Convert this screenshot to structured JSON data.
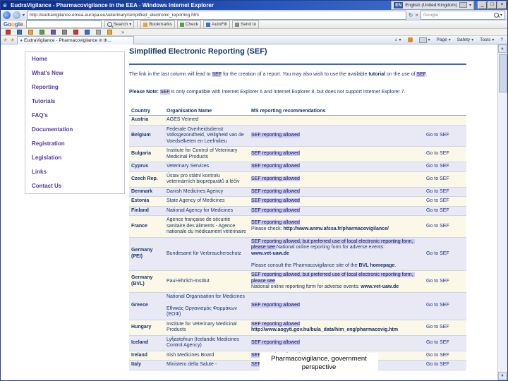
{
  "window": {
    "title": "EudraVigilance - Pharmacovigilance in the EEA - Windows Internet Explorer",
    "language_badge": "EN",
    "language_label": "English (United Kingdom)",
    "min_glyph": "_",
    "max_glyph": "□",
    "close_glyph": "×"
  },
  "icons": {
    "ie": "e",
    "back": "←",
    "forward": "→",
    "refresh": "↻",
    "stop": "×",
    "caret": "▾",
    "star": "★",
    "star_plus": "★",
    "favicon": "●",
    "home": "⌂",
    "help": "?",
    "up_arrow": "▲",
    "down_arrow": "▼",
    "overflow": "»"
  },
  "address_bar": {
    "url": "http://eudravigilance.emea.europa.eu/veterinary/simplified_electronic_reporting.htm",
    "search_placeholder": "Google"
  },
  "google_toolbar": {
    "logo": "Google",
    "logo_colors": [
      "#3366cc",
      "#cc3333",
      "#eeb211",
      "#3366cc",
      "#109d58",
      "#cc3333"
    ],
    "search_label": "Search",
    "items": [
      {
        "label": "Bookmarks",
        "icon": "bookmark-icon",
        "color": "#e8a33d"
      },
      {
        "label": "Check",
        "icon": "spellcheck-icon",
        "color": "#5a9e4a"
      },
      {
        "label": "AutoFill",
        "icon": "autofill-icon",
        "color": "#3a6fc4"
      },
      {
        "label": "Send to",
        "icon": "send-icon",
        "color": "#888888"
      }
    ]
  },
  "links_toolbar": {
    "icon_colors": [
      "#c23b2e",
      "#3a6fc4",
      "#e8a33d",
      "#5a9e4a",
      "#7a52a8",
      "#888888",
      "#c23b2e",
      "#3a6fc4",
      "#aaaaaa",
      "#e8a33d"
    ],
    "overflow_glyph": "»"
  },
  "tab_bar": {
    "tab_title": "EudraVigilance - Pharmacovigilance in th...",
    "commands": {
      "page": "Page",
      "safety": "Safety",
      "tools": "Tools",
      "help": "?"
    }
  },
  "sidebar": {
    "items": [
      "Home",
      "What's New",
      "Reporting",
      "Tutorials",
      "FAQ's",
      "Documentation",
      "Registration",
      "Legislation",
      "Links",
      "Contact Us"
    ]
  },
  "content": {
    "heading": "Simplified Electronic Reporting (SEF)",
    "intro_segments": [
      {
        "text": "The link in the last column will lead to ",
        "style": "plain"
      },
      {
        "text": "SEF",
        "style": "hl"
      },
      {
        "text": " for the creation of a report. You may also wish to use the available ",
        "style": "plain"
      },
      {
        "text": "tutorial",
        "style": "link"
      },
      {
        "text": " on the use of ",
        "style": "plain"
      },
      {
        "text": "SEF",
        "style": "hl"
      },
      {
        "text": ".",
        "style": "plain"
      }
    ],
    "note_segments": [
      {
        "text": "Please Note: ",
        "style": "bold"
      },
      {
        "text": "SEF",
        "style": "hl"
      },
      {
        "text": " is only compatible with Internet Explorer 6 and Internet Explorer 8, but does not support Internet Explorer 7.",
        "style": "plain"
      }
    ],
    "table": {
      "headers": [
        "Country",
        "Organisation Name",
        "MS reporting recommendations",
        ""
      ],
      "rows": [
        {
          "country": "Austria",
          "organisation": "AGES Vetmed",
          "recommendation": [],
          "link": ""
        },
        {
          "country": "Belgium",
          "organisation": "Federale Overheidsdienst Volksgezondheid, Veiligheid van de Voedselketen en Leefmilieu",
          "recommendation": [
            {
              "text": "SEF reporting allowed",
              "style": "hl"
            }
          ],
          "link": "Go to SEF"
        },
        {
          "country": "Bulgaria",
          "organisation": "Institute for Control of Veterinary Medicinal Products",
          "recommendation": [
            {
              "text": "SEF reporting allowed",
              "style": "hl"
            }
          ],
          "link": "Go to SEF"
        },
        {
          "country": "Cyprus",
          "organisation": "Veterinary Services",
          "recommendation": [
            {
              "text": "SEF reporting allowed",
              "style": "hl"
            }
          ],
          "link": "Go to SEF"
        },
        {
          "country": "Czech Rep.",
          "organisation": "Ústav pro státní kontrolu veterinárních biopreparátů a léčiv",
          "recommendation": [
            {
              "text": "SEF reporting allowed",
              "style": "hl"
            }
          ],
          "link": "Go to SEF"
        },
        {
          "country": "Denmark",
          "organisation": "Danish Medicines Agency",
          "recommendation": [
            {
              "text": "SEF reporting allowed",
              "style": "hl"
            }
          ],
          "link": "Go to SEF"
        },
        {
          "country": "Estonia",
          "organisation": "State Agency of Medicines",
          "recommendation": [
            {
              "text": "SEF reporting allowed",
              "style": "hl"
            }
          ],
          "link": "Go to SEF"
        },
        {
          "country": "Finland",
          "organisation": "National Agency for Medicines",
          "recommendation": [
            {
              "text": "SEF reporting allowed",
              "style": "hl"
            }
          ],
          "link": "Go to SEF"
        },
        {
          "country": "France",
          "organisation": "Agence française de sécurité sanitaire des aliments - Agence nationale du médicament vétérinaire",
          "recommendation": [
            {
              "text": "SEF reporting allowed",
              "style": "hl"
            },
            {
              "text": "\nPlease check: ",
              "style": "plain"
            },
            {
              "text": "http://www.anmv.afssa.fr/pharmacovigilance/",
              "style": "link"
            }
          ],
          "link": "Go to SEF"
        },
        {
          "country": "Germany (PEI)",
          "organisation": "Bundesamt für Verbraucherschutz",
          "recommendation": [
            {
              "text": "SEF reporting allowed, but preferred use of local electronic reporting form, please see ",
              "style": "hl"
            },
            {
              "text": "National online reporting form for adverse events:\n",
              "style": "plain"
            },
            {
              "text": "www.vet-uaw.de",
              "style": "link"
            },
            {
              "text": "\n\nPlease consult the Pharmacovigilance site of the ",
              "style": "plain"
            },
            {
              "text": "BVL homepage",
              "style": "link"
            },
            {
              "text": ".",
              "style": "plain"
            }
          ],
          "link": "Go to SEF"
        },
        {
          "country": "Germany (BVL)",
          "organisation": "Paul-Ehrlich-Institut",
          "recommendation": [
            {
              "text": "SEF reporting allowed, but preferred use of local electronic reporting form, please see\n",
              "style": "hl"
            },
            {
              "text": "National online reporting form for adverse events: ",
              "style": "plain"
            },
            {
              "text": "www.vet-uaw.de",
              "style": "link"
            }
          ],
          "link": "Go to SEF"
        },
        {
          "country": "Greece",
          "organisation": "National Organisation for Medicines\n\nΕθνικός Οργανισμός Φαρμάκων (ΕΟΦ)",
          "recommendation": [
            {
              "text": "SEF reporting allowed",
              "style": "hl"
            }
          ],
          "link": "Go to SEF"
        },
        {
          "country": "Hungary",
          "organisation": "Institute for Veterinary Medicinal Products",
          "recommendation": [
            {
              "text": "SEF reporting allowed",
              "style": "hl"
            },
            {
              "text": "\n",
              "style": "plain"
            },
            {
              "text": "http://www.aogyti.gov.hu/bula_data/him_eng/pharmacovig.htm",
              "style": "link"
            }
          ],
          "link": "Go to SEF"
        },
        {
          "country": "Iceland",
          "organisation": "Lyfjastofnun (Icelandic Medicines Control Agency)",
          "recommendation": [
            {
              "text": "SEF reporting allowed",
              "style": "hl"
            }
          ],
          "link": "Go to SEF"
        },
        {
          "country": "Ireland",
          "organisation": "Irish Medicines Board",
          "recommendation": [
            {
              "text": "SEF reporting allowed",
              "style": "hl"
            }
          ],
          "link": "Go to SEF"
        },
        {
          "country": "Italy",
          "organisation": "Ministero della Salute -",
          "recommendation": [
            {
              "text": "SEF reporting allowed",
              "style": "hl"
            }
          ],
          "link": "Go to SEF"
        }
      ]
    }
  },
  "caption": {
    "line1": "Pharmacovigilance, government",
    "line2": "perspective"
  },
  "colors": {
    "accent_navy": "#16356e",
    "highlight": "#cbcbee",
    "stripe_cream": "#fcf8e8",
    "stripe_lavender": "#e9e9f6",
    "sidebar_link": "#53389e"
  }
}
